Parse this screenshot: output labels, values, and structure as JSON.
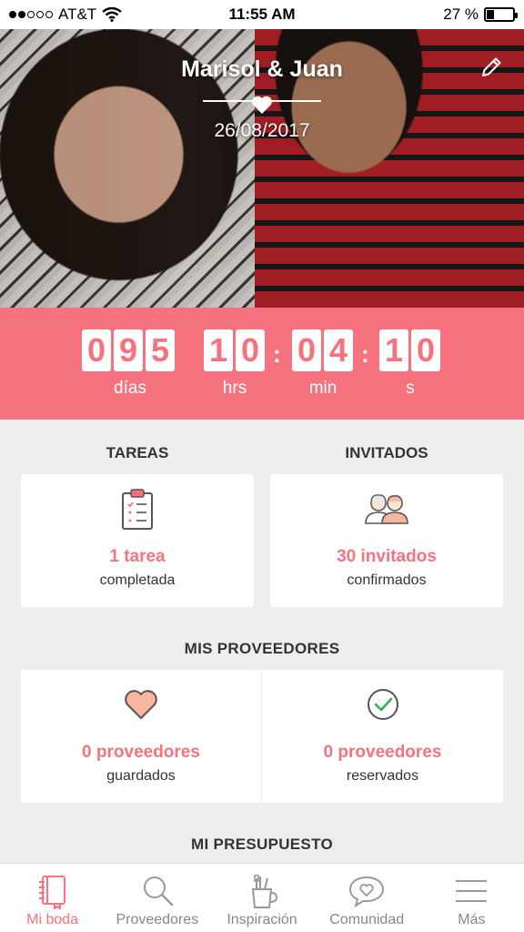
{
  "status_bar": {
    "carrier": "AT&T",
    "time": "11:55 AM",
    "battery": "27 %",
    "battery_level": 0.27
  },
  "hero": {
    "names": "Marisol & Juan",
    "date": "26/08/2017"
  },
  "countdown": {
    "days": [
      "0",
      "9",
      "5"
    ],
    "hours": [
      "1",
      "0"
    ],
    "minutes": [
      "0",
      "4"
    ],
    "seconds": [
      "1",
      "0"
    ],
    "labels": {
      "days": "días",
      "hours": "hrs",
      "minutes": "min",
      "seconds": "s"
    }
  },
  "tasks": {
    "title": "TAREAS",
    "value": "1 tarea",
    "sub": "completada"
  },
  "guests": {
    "title": "INVITADOS",
    "value": "30 invitados",
    "sub": "confirmados"
  },
  "vendors": {
    "title": "MIS PROVEEDORES",
    "saved": {
      "value": "0 proveedores",
      "sub": "guardados"
    },
    "booked": {
      "value": "0 proveedores",
      "sub": "reservados"
    }
  },
  "budget": {
    "title": "MI PRESUPUESTO"
  },
  "tabs": [
    {
      "label": "Mi boda",
      "icon": "notebook-icon",
      "active": true
    },
    {
      "label": "Proveedores",
      "icon": "search-icon",
      "active": false
    },
    {
      "label": "Inspiración",
      "icon": "brushes-icon",
      "active": false
    },
    {
      "label": "Comunidad",
      "icon": "chat-heart-icon",
      "active": false
    },
    {
      "label": "Más",
      "icon": "menu-icon",
      "active": false
    }
  ],
  "colors": {
    "accent": "#f6727f",
    "background": "#eeeeee",
    "peach": "#f8b79e",
    "check": "#2bb24c"
  }
}
